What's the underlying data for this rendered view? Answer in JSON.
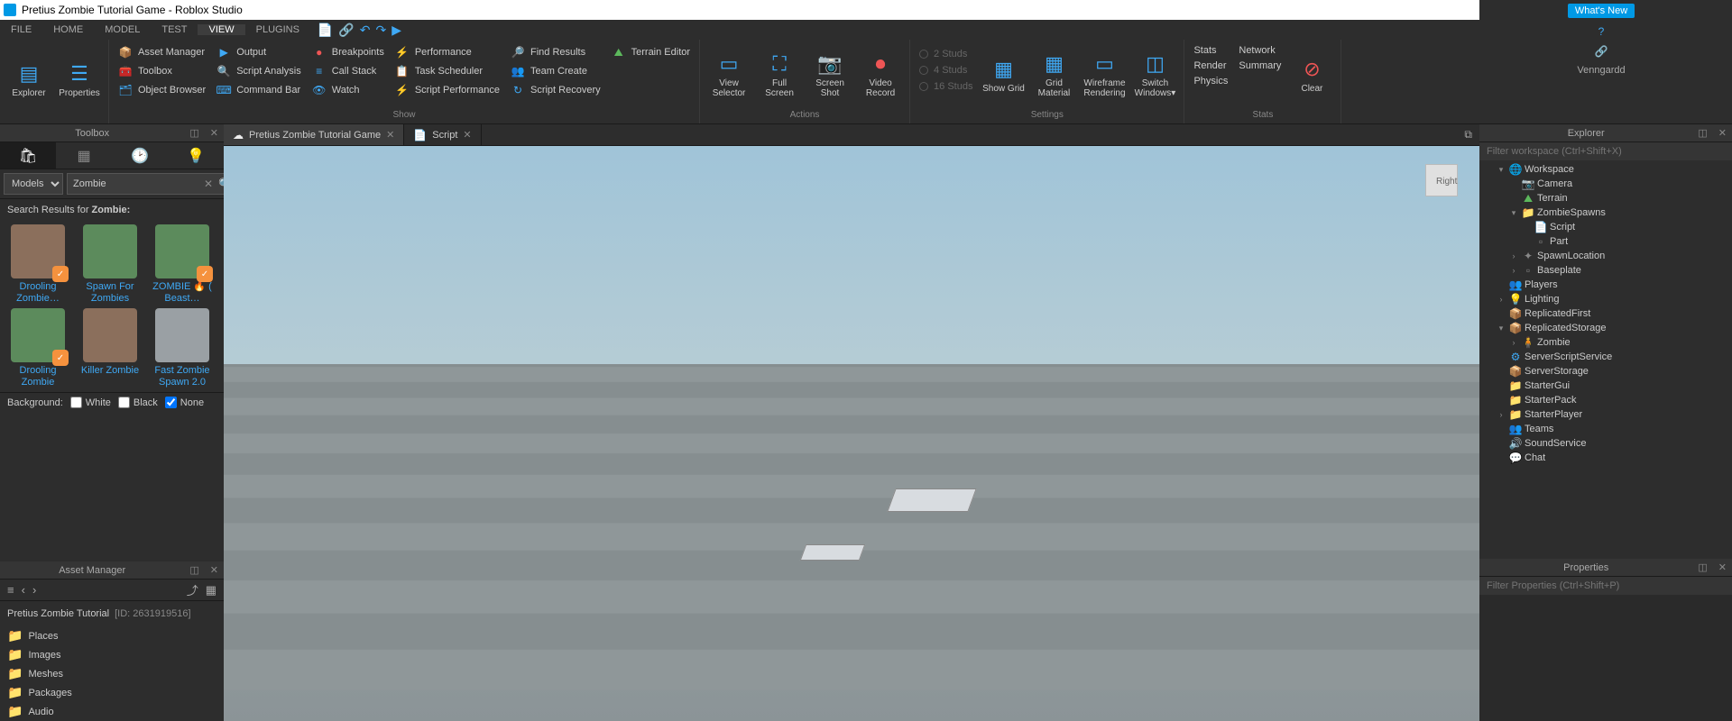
{
  "window": {
    "title": "Pretius Zombie Tutorial Game - Roblox Studio"
  },
  "menubar": {
    "items": [
      "FILE",
      "HOME",
      "MODEL",
      "TEST",
      "VIEW",
      "PLUGINS"
    ],
    "active": 4,
    "whatsnew": "What's New",
    "username": "Venngardd"
  },
  "ribbon": {
    "explorer": "Explorer",
    "properties": "Properties",
    "col1": [
      {
        "icon": "📦",
        "label": "Asset Manager",
        "c": "c-blue"
      },
      {
        "icon": "🧰",
        "label": "Toolbox",
        "c": "c-blue"
      },
      {
        "icon": "🗂",
        "label": "Object Browser",
        "c": "c-blue"
      }
    ],
    "col2": [
      {
        "icon": "▶",
        "label": "Output",
        "c": "c-blue"
      },
      {
        "icon": "🔍",
        "label": "Script Analysis",
        "c": "c-blue"
      },
      {
        "icon": "⌨",
        "label": "Command Bar",
        "c": "c-blue"
      }
    ],
    "col3": [
      {
        "icon": "●",
        "label": "Breakpoints",
        "c": "c-red"
      },
      {
        "icon": "≡",
        "label": "Call Stack",
        "c": "c-blue"
      },
      {
        "icon": "👁",
        "label": "Watch",
        "c": "c-blue"
      }
    ],
    "col4": [
      {
        "icon": "⚡",
        "label": "Performance",
        "c": "c-purple"
      },
      {
        "icon": "📋",
        "label": "Task Scheduler",
        "c": "c-blue"
      },
      {
        "icon": "⚡",
        "label": "Script Performance",
        "c": "c-purple"
      }
    ],
    "col5": [
      {
        "icon": "🔎",
        "label": "Find Results",
        "c": "c-blue"
      },
      {
        "icon": "👥",
        "label": "Team Create",
        "c": "c-cyan"
      },
      {
        "icon": "↻",
        "label": "Script Recovery",
        "c": "c-blue"
      }
    ],
    "terrain": "Terrain Editor",
    "show_lbl": "Show",
    "actions": [
      {
        "icon": "▭",
        "label": "View Selector",
        "c": "c-blue"
      },
      {
        "icon": "⛶",
        "label": "Full Screen",
        "c": "c-blue"
      },
      {
        "icon": "📷",
        "label": "Screen Shot",
        "c": "c-red"
      },
      {
        "icon": "⏺",
        "label": "Video Record",
        "c": "c-red"
      }
    ],
    "actions_lbl": "Actions",
    "studs": [
      "2 Studs",
      "4 Studs",
      "16 Studs"
    ],
    "settings": [
      {
        "icon": "▦",
        "label": "Show Grid",
        "c": "c-blue"
      },
      {
        "icon": "▦",
        "label": "Grid Material",
        "c": "c-blue"
      },
      {
        "icon": "▭",
        "label": "Wireframe Rendering",
        "c": "c-blue"
      },
      {
        "icon": "◫",
        "label": "Switch Windows▾",
        "c": "c-blue"
      }
    ],
    "settings_lbl": "Settings",
    "stats_col": [
      "Stats",
      "Render",
      "Physics"
    ],
    "stats_col2": [
      "Network",
      "Summary"
    ],
    "clear": "Clear",
    "stats_lbl": "Stats"
  },
  "toolbox": {
    "title": "Toolbox",
    "category": "Models",
    "search_value": "Zombie",
    "results_prefix": "Search Results for",
    "results_term": "Zombie:",
    "items": [
      {
        "name": "Drooling Zombie…",
        "badge": true,
        "col": "#8b6f5c"
      },
      {
        "name": "Spawn For Zombies",
        "badge": false,
        "col": "#5c8b5c"
      },
      {
        "name": "ZOMBIE 🔥 ( Beast…",
        "badge": true,
        "col": "#5c8b5c"
      },
      {
        "name": "Drooling Zombie",
        "badge": true,
        "col": "#5c8b5c"
      },
      {
        "name": "Killer Zombie",
        "badge": false,
        "col": "#8b6f5c"
      },
      {
        "name": "Fast Zombie Spawn 2.0",
        "badge": false,
        "col": "#9aa0a4"
      }
    ],
    "bg_label": "Background:",
    "bg_opts": [
      "White",
      "Black",
      "None"
    ]
  },
  "assetmgr": {
    "title": "Asset Manager",
    "project": "Pretius Zombie Tutorial",
    "project_id": "[ID: 2631919516]",
    "folders": [
      "Places",
      "Images",
      "Meshes",
      "Packages",
      "Audio"
    ]
  },
  "doctabs": [
    {
      "icon": "☁",
      "label": "Pretius Zombie Tutorial Game",
      "c": "c-white"
    },
    {
      "icon": "📄",
      "label": "Script",
      "c": "c-blue"
    }
  ],
  "viewport": {
    "gizmo": "Right"
  },
  "explorer": {
    "title": "Explorer",
    "filter_ph": "Filter workspace (Ctrl+Shift+X)",
    "tree": [
      {
        "d": 1,
        "arrow": "▾",
        "icon": "🌐",
        "c": "c-green",
        "label": "Workspace"
      },
      {
        "d": 2,
        "arrow": "",
        "icon": "📷",
        "c": "c-blue",
        "label": "Camera"
      },
      {
        "d": 2,
        "arrow": "",
        "icon": "⛰",
        "c": "c-green",
        "label": "Terrain"
      },
      {
        "d": 2,
        "arrow": "▾",
        "icon": "📁",
        "c": "c-yel",
        "label": "ZombieSpawns"
      },
      {
        "d": 3,
        "arrow": "",
        "icon": "📄",
        "c": "c-white",
        "label": "Script"
      },
      {
        "d": 3,
        "arrow": "",
        "icon": "▫",
        "c": "c-gray",
        "label": "Part"
      },
      {
        "d": 2,
        "arrow": "›",
        "icon": "✦",
        "c": "c-gray",
        "label": "SpawnLocation"
      },
      {
        "d": 2,
        "arrow": "›",
        "icon": "▫",
        "c": "c-gray",
        "label": "Baseplate"
      },
      {
        "d": 1,
        "arrow": "",
        "icon": "👥",
        "c": "c-orange",
        "label": "Players"
      },
      {
        "d": 1,
        "arrow": "›",
        "icon": "💡",
        "c": "c-yel",
        "label": "Lighting"
      },
      {
        "d": 1,
        "arrow": "",
        "icon": "📦",
        "c": "c-blue",
        "label": "ReplicatedFirst"
      },
      {
        "d": 1,
        "arrow": "▾",
        "icon": "📦",
        "c": "c-blue",
        "label": "ReplicatedStorage"
      },
      {
        "d": 2,
        "arrow": "›",
        "icon": "🧍",
        "c": "c-cyan",
        "label": "Zombie"
      },
      {
        "d": 1,
        "arrow": "",
        "icon": "⚙",
        "c": "c-blue",
        "label": "ServerScriptService"
      },
      {
        "d": 1,
        "arrow": "",
        "icon": "📦",
        "c": "c-blue",
        "label": "ServerStorage"
      },
      {
        "d": 1,
        "arrow": "",
        "icon": "📁",
        "c": "c-yel",
        "label": "StarterGui"
      },
      {
        "d": 1,
        "arrow": "",
        "icon": "📁",
        "c": "c-yel",
        "label": "StarterPack"
      },
      {
        "d": 1,
        "arrow": "›",
        "icon": "📁",
        "c": "c-yel",
        "label": "StarterPlayer"
      },
      {
        "d": 1,
        "arrow": "",
        "icon": "👥",
        "c": "c-blue",
        "label": "Teams"
      },
      {
        "d": 1,
        "arrow": "",
        "icon": "🔊",
        "c": "c-blue",
        "label": "SoundService"
      },
      {
        "d": 1,
        "arrow": "",
        "icon": "💬",
        "c": "c-blue",
        "label": "Chat"
      }
    ]
  },
  "properties": {
    "title": "Properties",
    "filter_ph": "Filter Properties (Ctrl+Shift+P)"
  }
}
